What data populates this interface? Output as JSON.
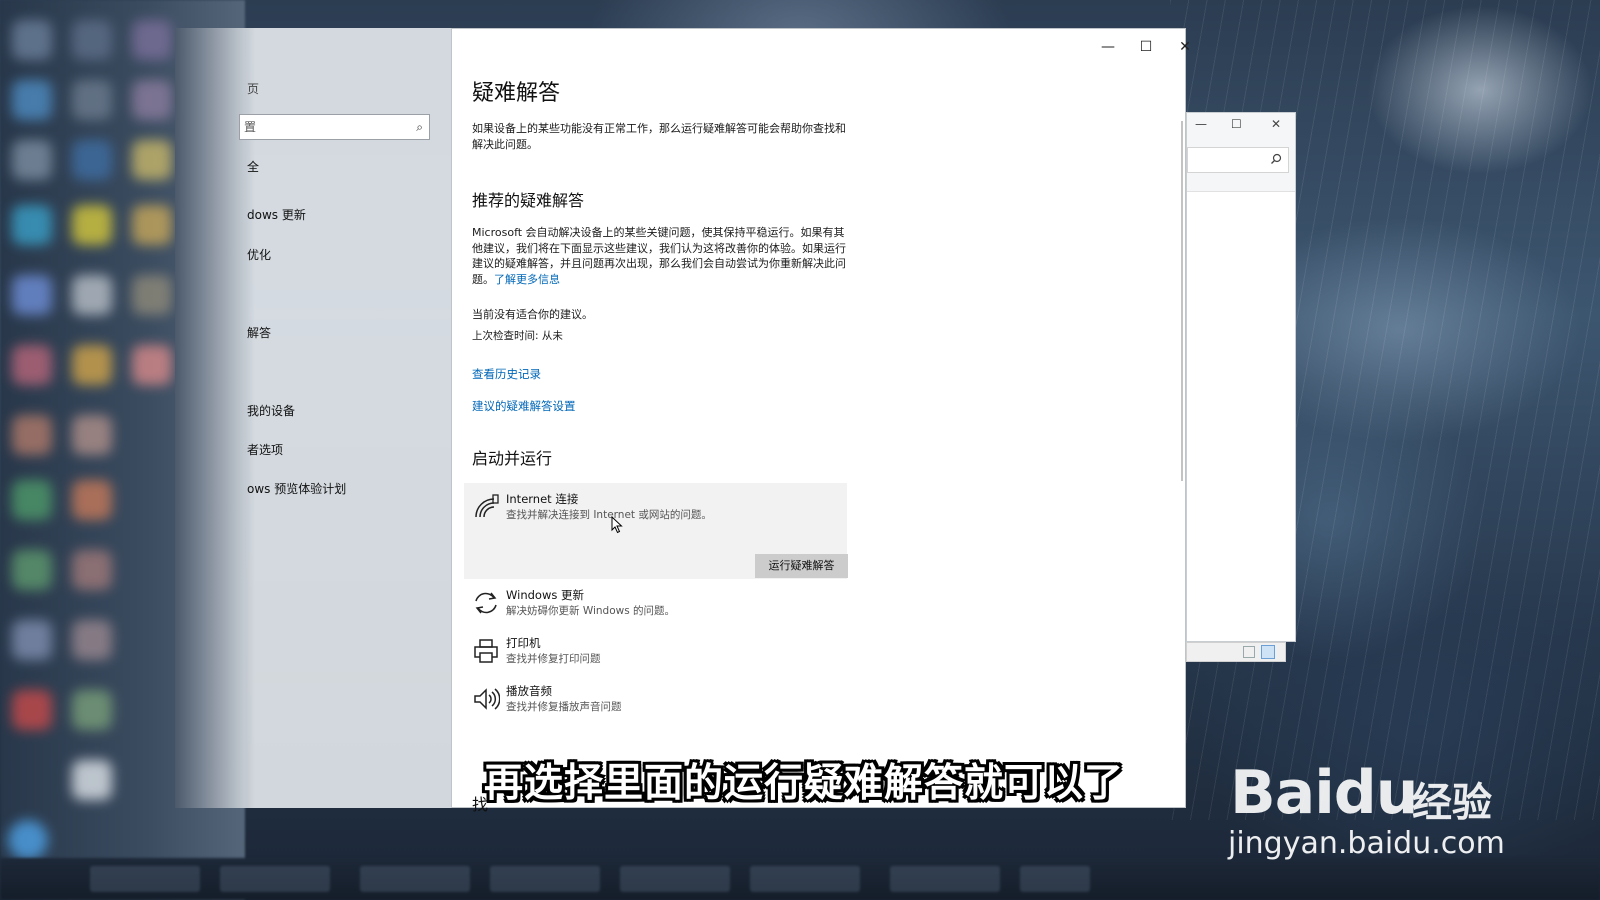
{
  "left_pane": {
    "items": [
      {
        "label": "页"
      },
      {
        "label": "全"
      },
      {
        "label": "dows 更新"
      },
      {
        "label": "优化"
      },
      {
        "label": "解答"
      },
      {
        "label": "我的设备"
      },
      {
        "label": "者选项"
      },
      {
        "label": "ows 预览体验计划"
      }
    ],
    "search_value": "置"
  },
  "window_controls": {
    "minimize": "—",
    "maximize": "☐",
    "close": "✕"
  },
  "page": {
    "title": "疑难解答",
    "intro": "如果设备上的某些功能没有正常工作，那么运行疑难解答可能会帮助你查找和解决此问题。",
    "recommended": {
      "heading": "推荐的疑难解答",
      "body": "Microsoft 会自动解决设备上的某些关键问题，使其保持平稳运行。如果有其他建议，我们将在下面显示这些建议，我们认为这将改善你的体验。如果运行建议的疑难解答，并且问题再次出现，那么我们会自动尝试为你重新解决此问题。",
      "learn_more": "了解更多信息",
      "no_suggestion": "当前没有适合你的建议。",
      "last_check": "上次检查时间: 从未",
      "history_link": "查看历史记录",
      "settings_link": "建议的疑难解答设置"
    },
    "get_running": {
      "heading": "启动并运行",
      "items": [
        {
          "title": "Internet 连接",
          "desc": "查找并解决连接到 Internet 或网站的问题。",
          "icon": "wifi-icon"
        },
        {
          "title": "Windows 更新",
          "desc": "解决妨碍你更新 Windows 的问题。",
          "icon": "refresh-icon"
        },
        {
          "title": "打印机",
          "desc": "查找并修复打印问题",
          "icon": "printer-icon"
        },
        {
          "title": "播放音频",
          "desc": "查找并修复播放声音问题",
          "icon": "speaker-icon"
        }
      ],
      "run_button": "运行疑难解答"
    },
    "partial_heading": "找"
  },
  "overlay": {
    "subtitle": "再选择里面的运行疑难解答就可以了",
    "watermark_logo": "Baidu",
    "watermark_cn": "经验",
    "watermark_url": "jingyan.baidu.com"
  }
}
